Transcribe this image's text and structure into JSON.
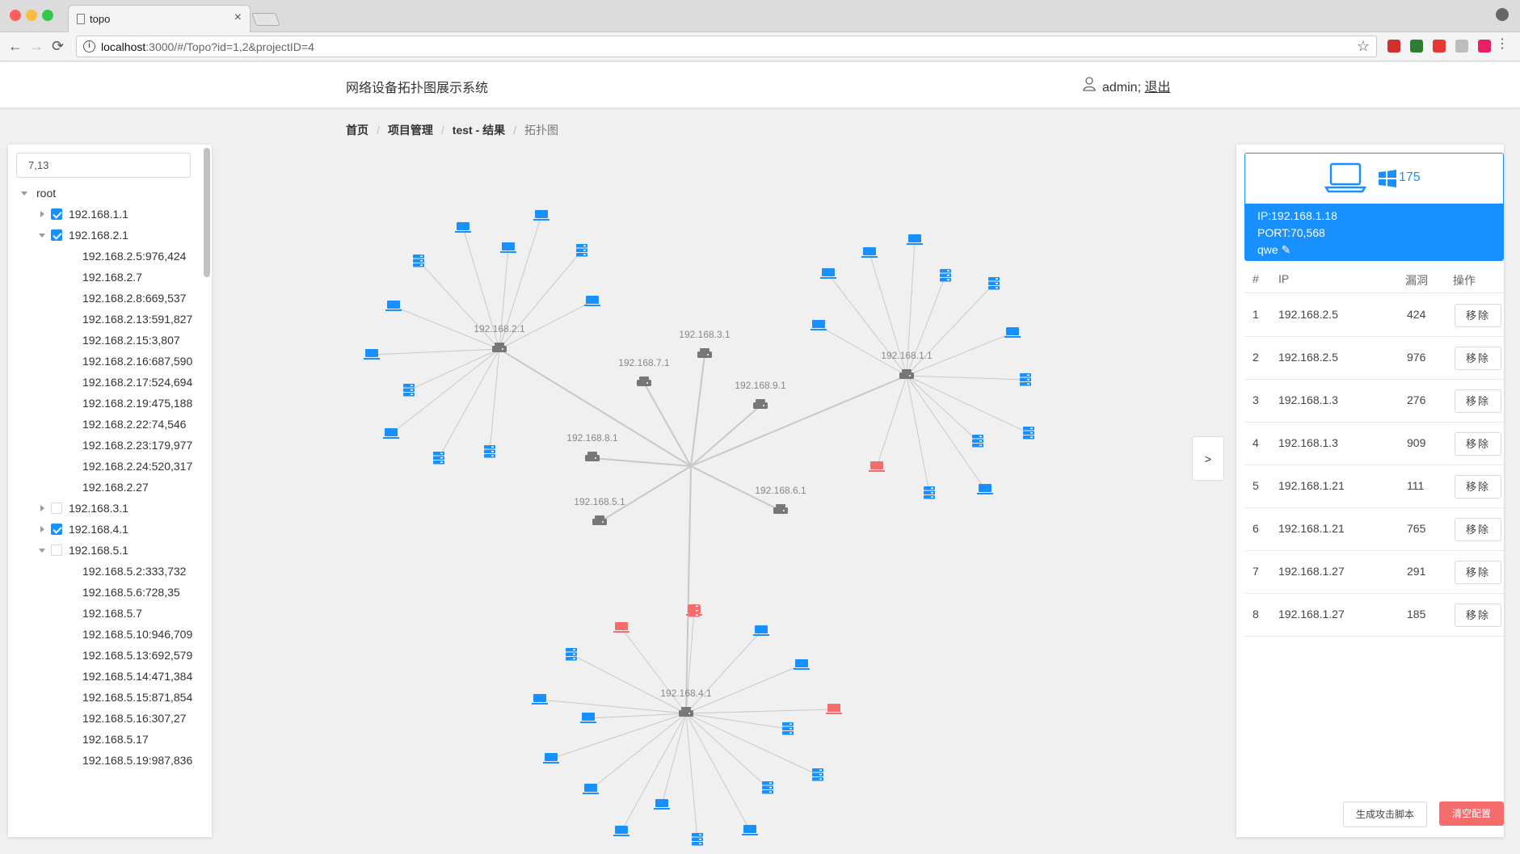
{
  "browser": {
    "tab_title": "topo",
    "tab_close": "×",
    "url_host": "localhost",
    "url_path": ":3000/#/Topo?id=1,2&projectID=4",
    "info_glyph": "i",
    "star_glyph": "☆",
    "back_glyph": "←",
    "forward_glyph": "→",
    "reload_glyph": "⟳",
    "menu_glyph": "⋮",
    "ext_colors": [
      "#d32f2f",
      "#2e7d32",
      "#e53935",
      "#bdbdbd",
      "#e91e63"
    ]
  },
  "header": {
    "title": "网络设备拓扑图展示系统",
    "user": "admin;",
    "logout": "退出"
  },
  "breadcrumb": [
    "首页",
    "项目管理",
    "test - 结果",
    "拓扑图"
  ],
  "tree": {
    "search_value": "7,13",
    "nodes": [
      {
        "label": "root",
        "level": 0,
        "caret": "down",
        "checkbox": null
      },
      {
        "label": "192.168.1.1",
        "level": 1,
        "caret": "right",
        "checkbox": true
      },
      {
        "label": "192.168.2.1",
        "level": 1,
        "caret": "down",
        "checkbox": true
      },
      {
        "label": "192.168.2.5:976,424",
        "level": 2,
        "caret": null,
        "checkbox": null
      },
      {
        "label": "192.168.2.7",
        "level": 2,
        "caret": null,
        "checkbox": null
      },
      {
        "label": "192.168.2.8:669,537",
        "level": 2,
        "caret": null,
        "checkbox": null
      },
      {
        "label": "192.168.2.13:591,827",
        "level": 2,
        "caret": null,
        "checkbox": null
      },
      {
        "label": "192.168.2.15:3,807",
        "level": 2,
        "caret": null,
        "checkbox": null
      },
      {
        "label": "192.168.2.16:687,590",
        "level": 2,
        "caret": null,
        "checkbox": null
      },
      {
        "label": "192.168.2.17:524,694",
        "level": 2,
        "caret": null,
        "checkbox": null
      },
      {
        "label": "192.168.2.19:475,188",
        "level": 2,
        "caret": null,
        "checkbox": null
      },
      {
        "label": "192.168.2.22:74,546",
        "level": 2,
        "caret": null,
        "checkbox": null
      },
      {
        "label": "192.168.2.23:179,977",
        "level": 2,
        "caret": null,
        "checkbox": null
      },
      {
        "label": "192.168.2.24:520,317",
        "level": 2,
        "caret": null,
        "checkbox": null
      },
      {
        "label": "192.168.2.27",
        "level": 2,
        "caret": null,
        "checkbox": null
      },
      {
        "label": "192.168.3.1",
        "level": 1,
        "caret": "right",
        "checkbox": false
      },
      {
        "label": "192.168.4.1",
        "level": 1,
        "caret": "right",
        "checkbox": true
      },
      {
        "label": "192.168.5.1",
        "level": 1,
        "caret": "down",
        "checkbox": false
      },
      {
        "label": "192.168.5.2:333,732",
        "level": 2,
        "caret": null,
        "checkbox": null
      },
      {
        "label": "192.168.5.6:728,35",
        "level": 2,
        "caret": null,
        "checkbox": null
      },
      {
        "label": "192.168.5.7",
        "level": 2,
        "caret": null,
        "checkbox": null
      },
      {
        "label": "192.168.5.10:946,709",
        "level": 2,
        "caret": null,
        "checkbox": null
      },
      {
        "label": "192.168.5.13:692,579",
        "level": 2,
        "caret": null,
        "checkbox": null
      },
      {
        "label": "192.168.5.14:471,384",
        "level": 2,
        "caret": null,
        "checkbox": null
      },
      {
        "label": "192.168.5.15:871,854",
        "level": 2,
        "caret": null,
        "checkbox": null
      },
      {
        "label": "192.168.5.16:307,27",
        "level": 2,
        "caret": null,
        "checkbox": null
      },
      {
        "label": "192.168.5.17",
        "level": 2,
        "caret": null,
        "checkbox": null
      },
      {
        "label": "192.168.5.19:987,836",
        "level": 2,
        "caret": null,
        "checkbox": null
      }
    ]
  },
  "topology": {
    "router_labels": [
      "192.168.2.1",
      "192.168.3.1",
      "192.168.7.1",
      "192.168.9.1",
      "192.168.1.1",
      "192.168.8.1",
      "192.168.6.1",
      "192.168.5.1",
      "192.168.4.1"
    ],
    "colors": {
      "pc": "#1890ff",
      "server": "#1890ff",
      "alert": "#f56c6c",
      "router": "#777777",
      "edge": "#c8c8c8"
    }
  },
  "expand_button": ">",
  "detail": {
    "vuln_count": "175",
    "ip": "IP:192.168.1.18",
    "port": "PORT:70,568",
    "note": "qwe",
    "edit_glyph": "✎",
    "columns": [
      "#",
      "IP",
      "漏洞",
      "操作"
    ],
    "rows": [
      {
        "n": "1",
        "ip": "192.168.2.5",
        "vuln": "424",
        "action": "移除"
      },
      {
        "n": "2",
        "ip": "192.168.2.5",
        "vuln": "976",
        "action": "移除"
      },
      {
        "n": "3",
        "ip": "192.168.1.3",
        "vuln": "276",
        "action": "移除"
      },
      {
        "n": "4",
        "ip": "192.168.1.3",
        "vuln": "909",
        "action": "移除"
      },
      {
        "n": "5",
        "ip": "192.168.1.21",
        "vuln": "111",
        "action": "移除"
      },
      {
        "n": "6",
        "ip": "192.168.1.21",
        "vuln": "765",
        "action": "移除"
      },
      {
        "n": "7",
        "ip": "192.168.1.27",
        "vuln": "291",
        "action": "移除"
      },
      {
        "n": "8",
        "ip": "192.168.1.27",
        "vuln": "185",
        "action": "移除"
      }
    ],
    "generate_button": "生成攻击脚本",
    "clear_button": "清空配置"
  }
}
